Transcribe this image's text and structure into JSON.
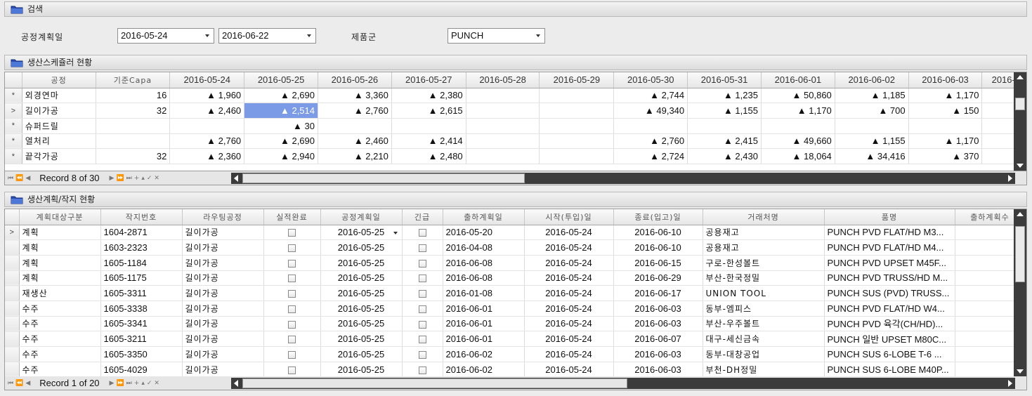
{
  "search": {
    "title": "검색",
    "date_label": "공정계획일",
    "date_from": "2016-05-24",
    "date_to": "2016-06-22",
    "product_label": "제품군",
    "product_value": "PUNCH"
  },
  "schedule": {
    "title": "생산스케쥴러 현황",
    "columns": [
      "공정",
      "기준Capa",
      "2016-05-24",
      "2016-05-25",
      "2016-05-26",
      "2016-05-27",
      "2016-05-28",
      "2016-05-29",
      "2016-05-30",
      "2016-05-31",
      "2016-06-01",
      "2016-06-02",
      "2016-06-03",
      "2016-"
    ],
    "rows": [
      {
        "indicator": "*",
        "cells": [
          "외경연마",
          "16",
          "▲ 1,960",
          "▲ 2,690",
          "▲ 3,360",
          "▲ 2,380",
          "",
          "",
          "▲ 2,744",
          "▲ 1,235",
          "▲ 50,860",
          "▲ 1,185",
          "▲ 1,170",
          ""
        ]
      },
      {
        "indicator": ">",
        "cells": [
          "길이가공",
          "32",
          "▲ 2,460",
          "▲ 2,514",
          "▲ 2,760",
          "▲ 2,615",
          "",
          "",
          "▲ 49,340",
          "▲ 1,155",
          "▲ 1,170",
          "▲ 700",
          "▲ 150",
          ""
        ]
      },
      {
        "indicator": "*",
        "cells": [
          "슈퍼드릴",
          "",
          "",
          "▲ 30",
          "",
          "",
          "",
          "",
          "",
          "",
          "",
          "",
          "",
          ""
        ]
      },
      {
        "indicator": "*",
        "cells": [
          "열처리",
          "",
          "▲ 2,760",
          "▲ 2,690",
          "▲ 2,460",
          "▲ 2,414",
          "",
          "",
          "▲ 2,760",
          "▲ 2,415",
          "▲ 49,660",
          "▲ 1,155",
          "▲ 1,170",
          ""
        ]
      },
      {
        "indicator": "*",
        "cells": [
          "끝각가공",
          "32",
          "▲ 2,360",
          "▲ 2,940",
          "▲ 2,210",
          "▲ 2,480",
          "",
          "",
          "▲ 2,724",
          "▲ 2,430",
          "▲ 18,064",
          "▲ 34,416",
          "▲ 370",
          ""
        ]
      }
    ],
    "record_text": "Record 8 of 30"
  },
  "plan": {
    "title": "생산계획/작지 현황",
    "columns": [
      "계획대상구분",
      "작지번호",
      "라우팅공정",
      "실적완료",
      "공정계획일",
      "긴급",
      "출하계획일",
      "시작(투입)일",
      "종료(입고)일",
      "거래처명",
      "품명",
      "출하계획수"
    ],
    "rows": [
      {
        "indicator": ">",
        "type": "계획",
        "order": "1604-2871",
        "routing": "길이가공",
        "plan_date": "2016-05-25",
        "ship": "2016-05-20",
        "start": "2016-05-24",
        "end": "2016-06-10",
        "client": "공용재고",
        "item": "PUNCH PVD FLAT/HD M3..."
      },
      {
        "indicator": "",
        "type": "계획",
        "order": "1603-2323",
        "routing": "길이가공",
        "plan_date": "2016-05-25",
        "ship": "2016-04-08",
        "start": "2016-05-24",
        "end": "2016-06-10",
        "client": "공용재고",
        "item": "PUNCH PVD FLAT/HD M4..."
      },
      {
        "indicator": "",
        "type": "계획",
        "order": "1605-1184",
        "routing": "길이가공",
        "plan_date": "2016-05-25",
        "ship": "2016-06-08",
        "start": "2016-05-24",
        "end": "2016-06-15",
        "client": "구로-한성볼트",
        "item": "PUNCH PVD UPSET M45F..."
      },
      {
        "indicator": "",
        "type": "계획",
        "order": "1605-1175",
        "routing": "길이가공",
        "plan_date": "2016-05-25",
        "ship": "2016-06-08",
        "start": "2016-05-24",
        "end": "2016-06-29",
        "client": "부산-한국정밀",
        "item": "PUNCH PVD TRUSS/HD M..."
      },
      {
        "indicator": "",
        "type": "재생산",
        "order": "1605-3311",
        "routing": "길이가공",
        "plan_date": "2016-05-25",
        "ship": "2016-01-08",
        "start": "2016-05-24",
        "end": "2016-06-17",
        "client": "UNION TOOL",
        "item": "PUNCH SUS (PVD) TRUSS..."
      },
      {
        "indicator": "",
        "type": "수주",
        "order": "1605-3338",
        "routing": "길이가공",
        "plan_date": "2016-05-25",
        "ship": "2016-06-01",
        "start": "2016-05-24",
        "end": "2016-06-03",
        "client": "동부-엠피스",
        "item": "PUNCH PVD FLAT/HD W4..."
      },
      {
        "indicator": "",
        "type": "수주",
        "order": "1605-3341",
        "routing": "길이가공",
        "plan_date": "2016-05-25",
        "ship": "2016-06-01",
        "start": "2016-05-24",
        "end": "2016-06-03",
        "client": "부산-우주볼트",
        "item": "PUNCH PVD 육각(CH/HD)..."
      },
      {
        "indicator": "",
        "type": "수주",
        "order": "1605-3211",
        "routing": "길이가공",
        "plan_date": "2016-05-25",
        "ship": "2016-06-01",
        "start": "2016-05-24",
        "end": "2016-06-07",
        "client": "대구-세신금속",
        "item": "PUNCH 일반 UPSET M80C..."
      },
      {
        "indicator": "",
        "type": "수주",
        "order": "1605-3350",
        "routing": "길이가공",
        "plan_date": "2016-05-25",
        "ship": "2016-06-02",
        "start": "2016-05-24",
        "end": "2016-06-03",
        "client": "동부-대창공업",
        "item": "PUNCH SUS 6-LOBE T-6 ..."
      },
      {
        "indicator": "",
        "type": "수주",
        "order": "1605-4029",
        "routing": "길이가공",
        "plan_date": "2016-05-25",
        "ship": "2016-06-02",
        "start": "2016-05-24",
        "end": "2016-06-03",
        "client": "부천-DH정밀",
        "item": "PUNCH SUS 6-LOBE M40P..."
      }
    ],
    "record_text": "Record 1 of 20"
  },
  "nav_buttons": [
    "first",
    "prev-page",
    "prev",
    "next",
    "next-page",
    "last",
    "add",
    "up",
    "save",
    "delete"
  ],
  "icons": [
    "folder-icon",
    "dropdown-arrow-icon",
    "checkbox-icon"
  ],
  "colors": {
    "selected_cell": "#7b9be6",
    "scroll_track": "#3c3c3c",
    "header_bg": "#e6e6e6"
  }
}
